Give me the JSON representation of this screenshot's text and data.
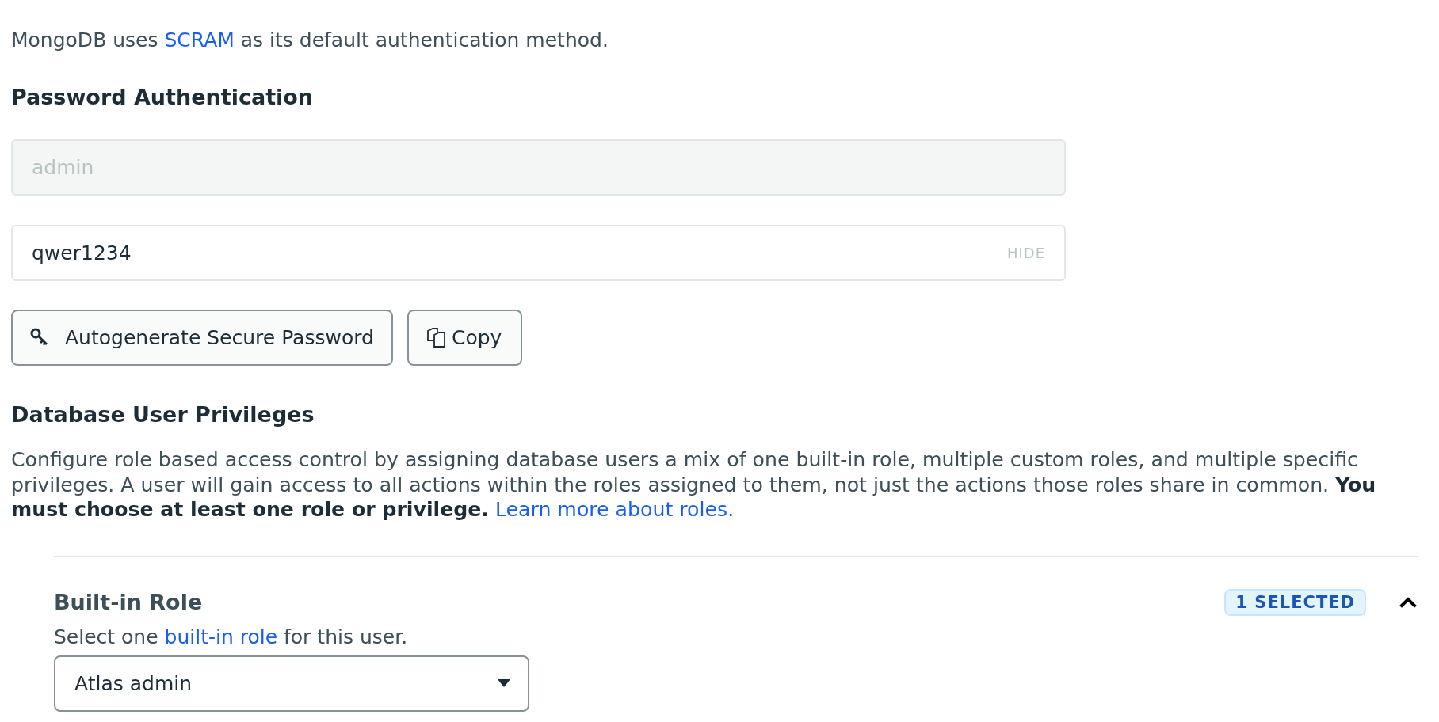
{
  "intro": {
    "before": "MongoDB uses",
    "link": "SCRAM",
    "after": "as its default authentication method."
  },
  "password_section": {
    "title": "Password Authentication",
    "username": {
      "value": "admin",
      "disabled": true
    },
    "password": {
      "value": "qwer1234",
      "toggle": "HIDE",
      "disabled": false
    },
    "buttons": [
      {
        "kind": "key",
        "label": "Autogenerate Secure Password"
      },
      {
        "kind": "copy",
        "label": "Copy"
      }
    ]
  },
  "privileges": {
    "title": "Database User Privileges",
    "text": "Configure role based access control by assigning database users a mix of one built-in role, multiple custom roles, and multiple specific privileges. A user will gain access to all actions within the roles assigned to them, not just the actions those roles share in common. **You must choose at least one role or privilege.**",
    "link": "Learn more about roles."
  },
  "built_in_role": {
    "title": "Built-in Role",
    "badge": "1 SELECTED",
    "expanded": true,
    "hint_before": "Select one",
    "hint_link": "built-in role",
    "hint_after": "for this user.",
    "dropdown": {
      "value": "Atlas admin"
    }
  }
}
